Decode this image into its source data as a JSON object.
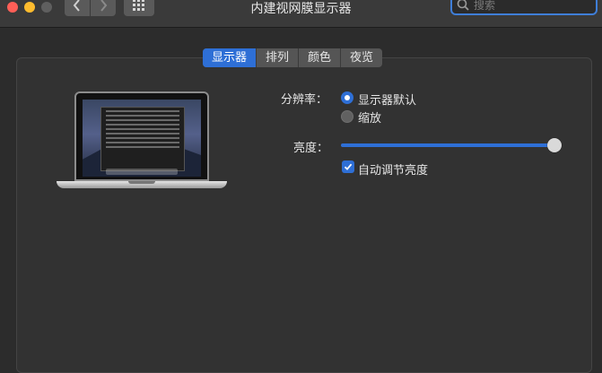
{
  "window": {
    "title": "内建视网膜显示器"
  },
  "search": {
    "placeholder": "搜索"
  },
  "tabs": [
    {
      "label": "显示器",
      "selected": true
    },
    {
      "label": "排列",
      "selected": false
    },
    {
      "label": "颜色",
      "selected": false
    },
    {
      "label": "夜览",
      "selected": false
    }
  ],
  "resolution": {
    "label": "分辨率：",
    "options": [
      {
        "label": "显示器默认",
        "selected": true
      },
      {
        "label": "缩放",
        "selected": false
      }
    ]
  },
  "brightness": {
    "label": "亮度：",
    "level_percent": 100,
    "auto_label": "自动调节亮度",
    "auto_checked": true
  },
  "colors": {
    "accent": "#2e6fd6"
  }
}
